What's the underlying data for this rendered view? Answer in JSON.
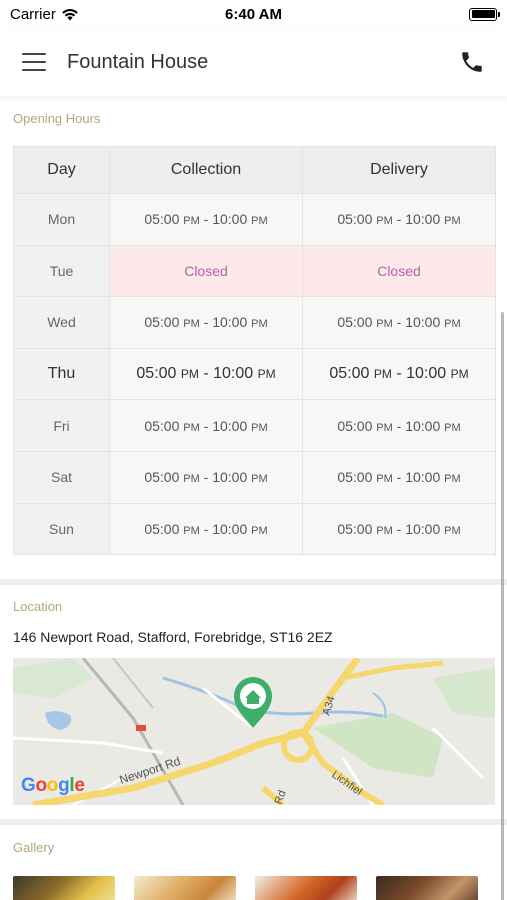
{
  "status_bar": {
    "carrier": "Carrier",
    "time": "6:40 AM"
  },
  "header": {
    "title": "Fountain House",
    "menu_icon": "hamburger-menu-icon",
    "phone_icon": "phone-icon"
  },
  "opening_hours": {
    "label": "Opening Hours",
    "columns": [
      "Day",
      "Collection",
      "Delivery"
    ],
    "rows": [
      {
        "day": "Mon",
        "collection": {
          "open": "05:00",
          "open_suffix": "PM",
          "close": "10:00",
          "close_suffix": "PM"
        },
        "delivery": {
          "open": "05:00",
          "open_suffix": "PM",
          "close": "10:00",
          "close_suffix": "PM"
        }
      },
      {
        "day": "Tue",
        "closed_label": "Closed"
      },
      {
        "day": "Wed",
        "collection": {
          "open": "05:00",
          "open_suffix": "PM",
          "close": "10:00",
          "close_suffix": "PM"
        },
        "delivery": {
          "open": "05:00",
          "open_suffix": "PM",
          "close": "10:00",
          "close_suffix": "PM"
        }
      },
      {
        "day": "Thu",
        "collection": {
          "open": "05:00",
          "open_suffix": "PM",
          "close": "10:00",
          "close_suffix": "PM"
        },
        "delivery": {
          "open": "05:00",
          "open_suffix": "PM",
          "close": "10:00",
          "close_suffix": "PM"
        }
      },
      {
        "day": "Fri",
        "collection": {
          "open": "05:00",
          "open_suffix": "PM",
          "close": "10:00",
          "close_suffix": "PM"
        },
        "delivery": {
          "open": "05:00",
          "open_suffix": "PM",
          "close": "10:00",
          "close_suffix": "PM"
        }
      },
      {
        "day": "Sat",
        "collection": {
          "open": "05:00",
          "open_suffix": "PM",
          "close": "10:00",
          "close_suffix": "PM"
        },
        "delivery": {
          "open": "05:00",
          "open_suffix": "PM",
          "close": "10:00",
          "close_suffix": "PM"
        }
      },
      {
        "day": "Sun",
        "collection": {
          "open": "05:00",
          "open_suffix": "PM",
          "close": "10:00",
          "close_suffix": "PM"
        },
        "delivery": {
          "open": "05:00",
          "open_suffix": "PM",
          "close": "10:00",
          "close_suffix": "PM"
        }
      }
    ],
    "separator": " - "
  },
  "location": {
    "label": "Location",
    "address": "146 Newport Road, Stafford, Forebridge, ST16 2EZ",
    "map": {
      "road_labels": [
        "Newport Rd",
        "A34",
        "Lichfiel",
        "Rd"
      ],
      "logo": "Google",
      "marker_icon": "home-marker-icon"
    }
  },
  "gallery": {
    "label": "Gallery",
    "images": [
      "gallery-photo-1",
      "gallery-photo-2",
      "gallery-photo-3",
      "gallery-photo-4"
    ]
  },
  "colors": {
    "section_label": "#b5a57a",
    "closed_text": "#b65fae",
    "closed_bg": "#fde8ea",
    "marker": "#3fae6a"
  }
}
